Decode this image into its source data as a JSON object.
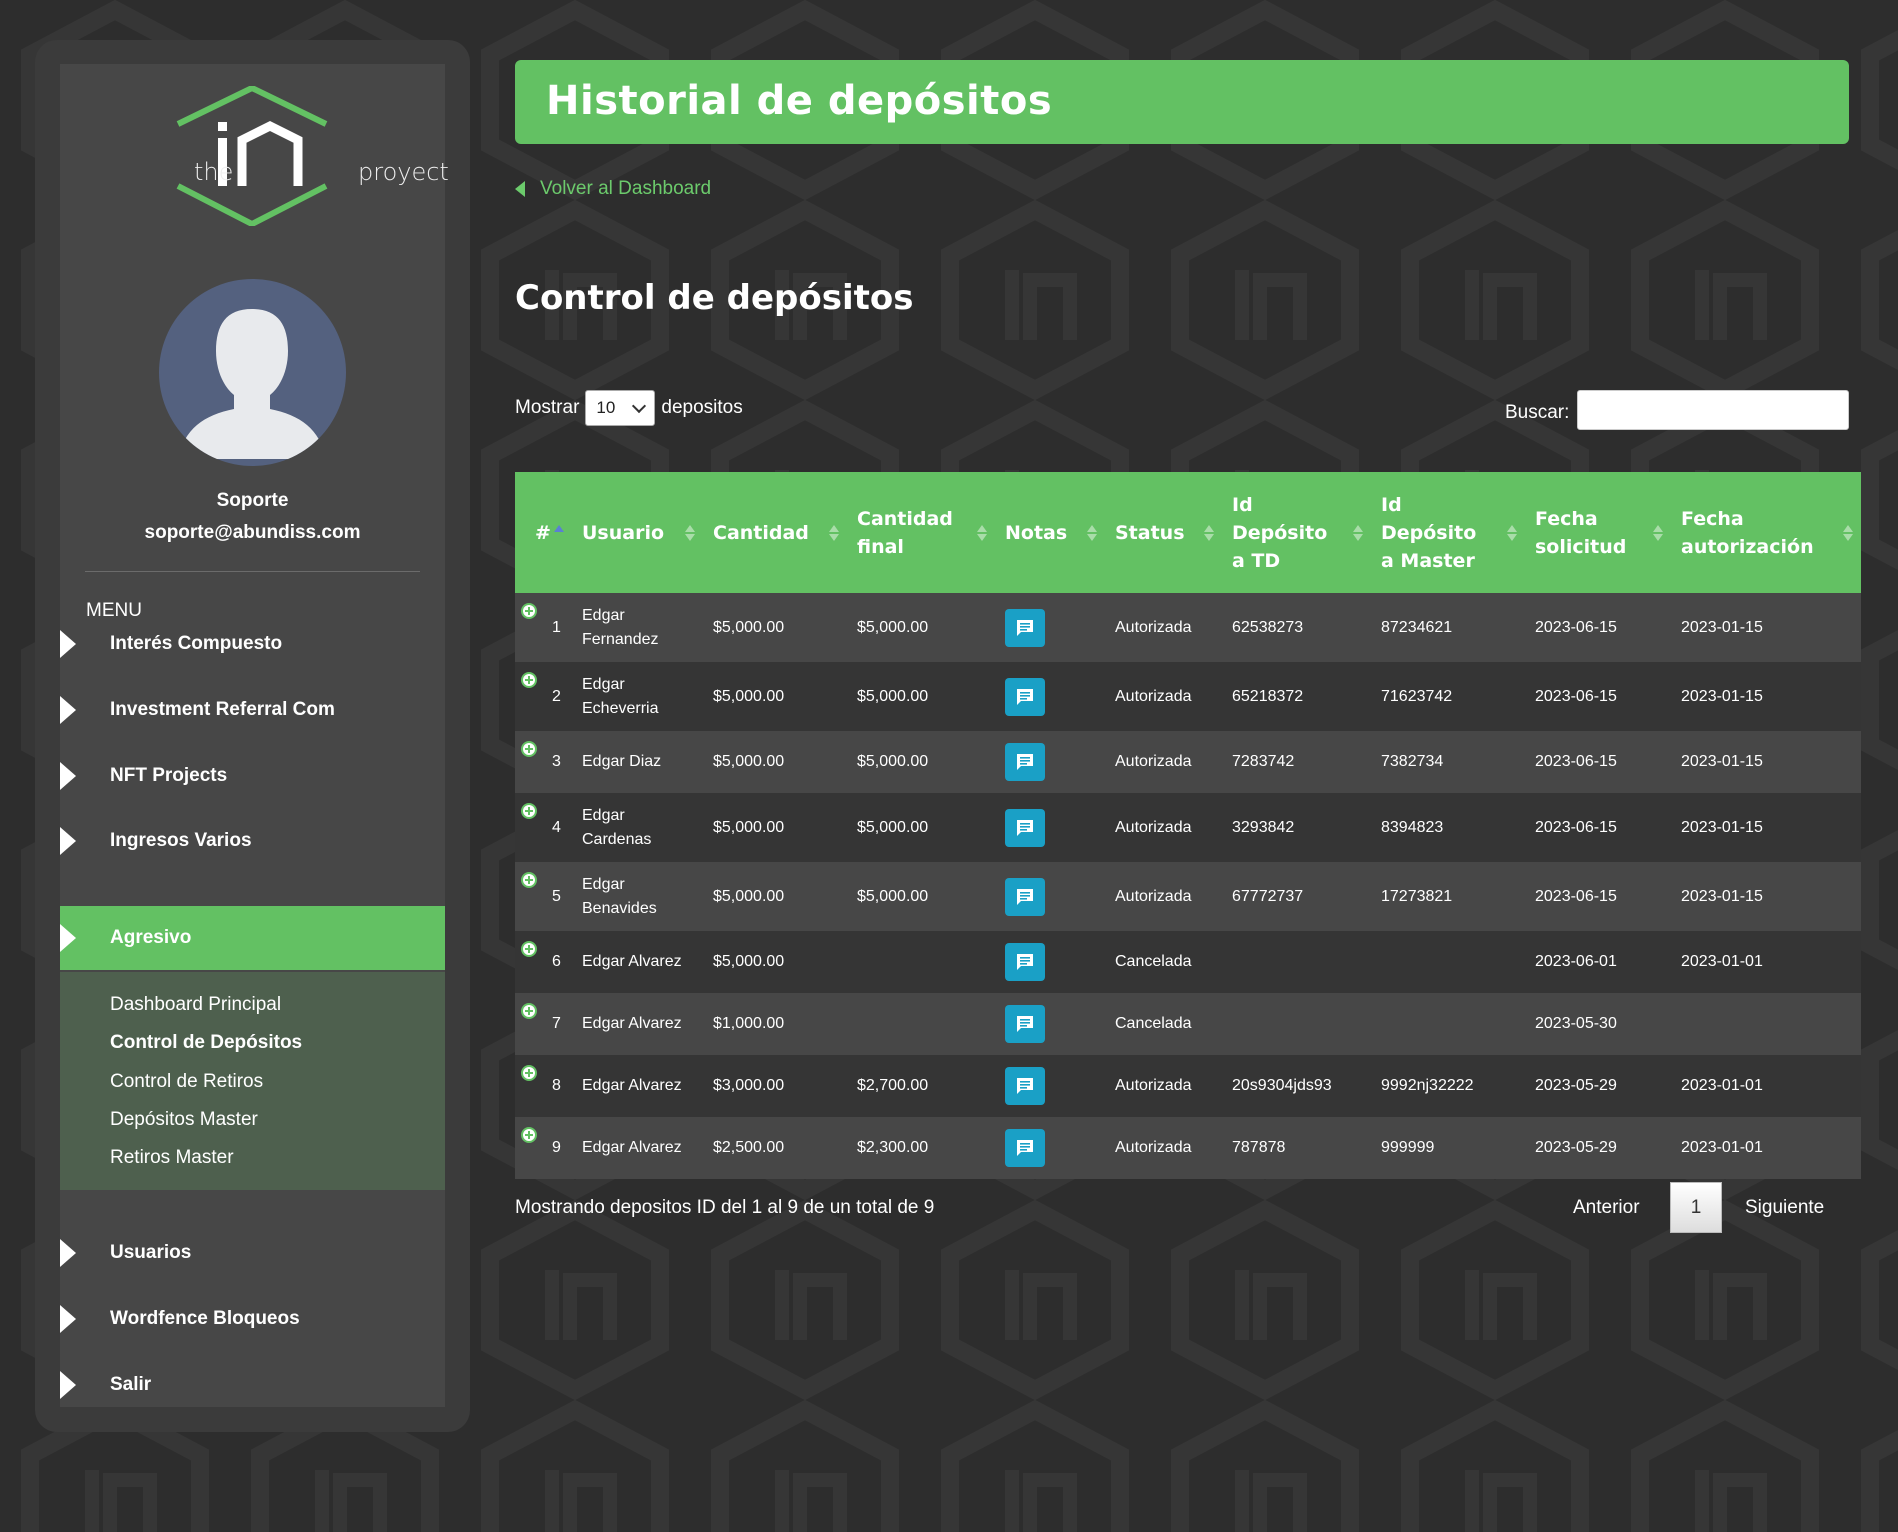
{
  "sidebar": {
    "logo": {
      "left_text": "the",
      "right_text": "proyect"
    },
    "user": {
      "name": "Soporte",
      "email": "soporte@abundiss.com"
    },
    "menu_label": "MENU",
    "items": [
      {
        "label": "Interés Compuesto"
      },
      {
        "label": "Investment Referral Com"
      },
      {
        "label": "NFT Projects"
      },
      {
        "label": "Ingresos Varios"
      },
      {
        "label": "Agresivo",
        "active": true
      },
      {
        "label": "Usuarios"
      },
      {
        "label": "Wordfence Bloqueos"
      },
      {
        "label": "Salir"
      }
    ],
    "submenu": [
      {
        "label": "Dashboard Principal"
      },
      {
        "label": "Control de Depósitos",
        "current": true
      },
      {
        "label": "Control de Retiros"
      },
      {
        "label": "Depósitos Master"
      },
      {
        "label": "Retiros Master"
      }
    ]
  },
  "header": {
    "title": "Historial de depósitos"
  },
  "back_link": "Volver al Dashboard",
  "section_title": "Control de depósitos",
  "controls": {
    "show_prefix": "Mostrar",
    "show_value": "10",
    "show_suffix": "depositos",
    "search_label": "Buscar:",
    "search_value": ""
  },
  "table": {
    "columns": [
      "#",
      "Usuario",
      "Cantidad",
      "Cantidad final",
      "Notas",
      "Status",
      "Id Depósito a TD",
      "Id Depósito a Master",
      "Fecha solicitud",
      "Fecha autorización"
    ],
    "rows": [
      {
        "n": "1",
        "usuario": "Edgar Fernandez",
        "cantidad": "$5,000.00",
        "final": "$5,000.00",
        "status": "Autorizada",
        "id_td": "62538273",
        "id_master": "87234621",
        "solicitud": "2023-06-15",
        "autorizacion": "2023-01-15"
      },
      {
        "n": "2",
        "usuario": "Edgar Echeverria",
        "cantidad": "$5,000.00",
        "final": "$5,000.00",
        "status": "Autorizada",
        "id_td": "65218372",
        "id_master": "71623742",
        "solicitud": "2023-06-15",
        "autorizacion": "2023-01-15"
      },
      {
        "n": "3",
        "usuario": "Edgar Diaz",
        "cantidad": "$5,000.00",
        "final": "$5,000.00",
        "status": "Autorizada",
        "id_td": "7283742",
        "id_master": "7382734",
        "solicitud": "2023-06-15",
        "autorizacion": "2023-01-15"
      },
      {
        "n": "4",
        "usuario": "Edgar Cardenas",
        "cantidad": "$5,000.00",
        "final": "$5,000.00",
        "status": "Autorizada",
        "id_td": "3293842",
        "id_master": "8394823",
        "solicitud": "2023-06-15",
        "autorizacion": "2023-01-15"
      },
      {
        "n": "5",
        "usuario": "Edgar Benavides",
        "cantidad": "$5,000.00",
        "final": "$5,000.00",
        "status": "Autorizada",
        "id_td": "67772737",
        "id_master": "17273821",
        "solicitud": "2023-06-15",
        "autorizacion": "2023-01-15"
      },
      {
        "n": "6",
        "usuario": "Edgar Alvarez",
        "cantidad": "$5,000.00",
        "final": "",
        "status": "Cancelada",
        "id_td": "",
        "id_master": "",
        "solicitud": "2023-06-01",
        "autorizacion": "2023-01-01"
      },
      {
        "n": "7",
        "usuario": "Edgar Alvarez",
        "cantidad": "$1,000.00",
        "final": "",
        "status": "Cancelada",
        "id_td": "",
        "id_master": "",
        "solicitud": "2023-05-30",
        "autorizacion": ""
      },
      {
        "n": "8",
        "usuario": "Edgar Alvarez",
        "cantidad": "$3,000.00",
        "final": "$2,700.00",
        "status": "Autorizada",
        "id_td": "20s9304jds93",
        "id_master": "9992nj32222",
        "solicitud": "2023-05-29",
        "autorizacion": "2023-01-01"
      },
      {
        "n": "9",
        "usuario": "Edgar Alvarez",
        "cantidad": "$2,500.00",
        "final": "$2,300.00",
        "status": "Autorizada",
        "id_td": "787878",
        "id_master": "999999",
        "solicitud": "2023-05-29",
        "autorizacion": "2023-01-01"
      }
    ]
  },
  "footer": {
    "info": "Mostrando depositos ID del 1 al 9 de un total de 9",
    "prev": "Anterior",
    "page": "1",
    "next": "Siguiente"
  },
  "colors": {
    "accent": "#63c163",
    "note_button": "#1aa0c6",
    "background": "#2d2d2d"
  }
}
